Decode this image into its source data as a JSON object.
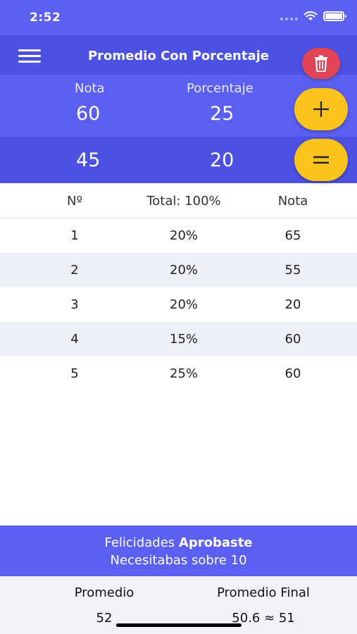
{
  "status": {
    "time": "2:52"
  },
  "app_bar": {
    "title": "Promedio Con Porcentaje",
    "menu_icon": "hamburger-menu-icon",
    "delete_icon": "trash-icon"
  },
  "input": {
    "nota_label": "Nota",
    "porcentaje_label": "Porcentaje",
    "row1": {
      "nota": "60",
      "porcentaje": "25"
    },
    "row2": {
      "nota": "45",
      "porcentaje": "20"
    },
    "add_icon": "plus-icon",
    "equals_icon": "equals-icon"
  },
  "table": {
    "headers": [
      "Nº",
      "Total: 100%",
      "Nota"
    ],
    "rows": [
      [
        "1",
        "20%",
        "65"
      ],
      [
        "2",
        "20%",
        "55"
      ],
      [
        "3",
        "20%",
        "20"
      ],
      [
        "4",
        "15%",
        "60"
      ],
      [
        "5",
        "25%",
        "60"
      ]
    ]
  },
  "result": {
    "line1_prefix": "Felicidades",
    "line1_bold": "Aprobaste",
    "line2": "Necesitabas sobre 10"
  },
  "summary": {
    "promedio_label": "Promedio",
    "promedio_value": "52",
    "final_label": "Promedio Final",
    "final_value": "50.6 ≈ 51"
  },
  "colors": {
    "primary": "#5b60f2",
    "primary_dark": "#4c51e3",
    "accent": "#fbc31b",
    "danger": "#e14455"
  }
}
